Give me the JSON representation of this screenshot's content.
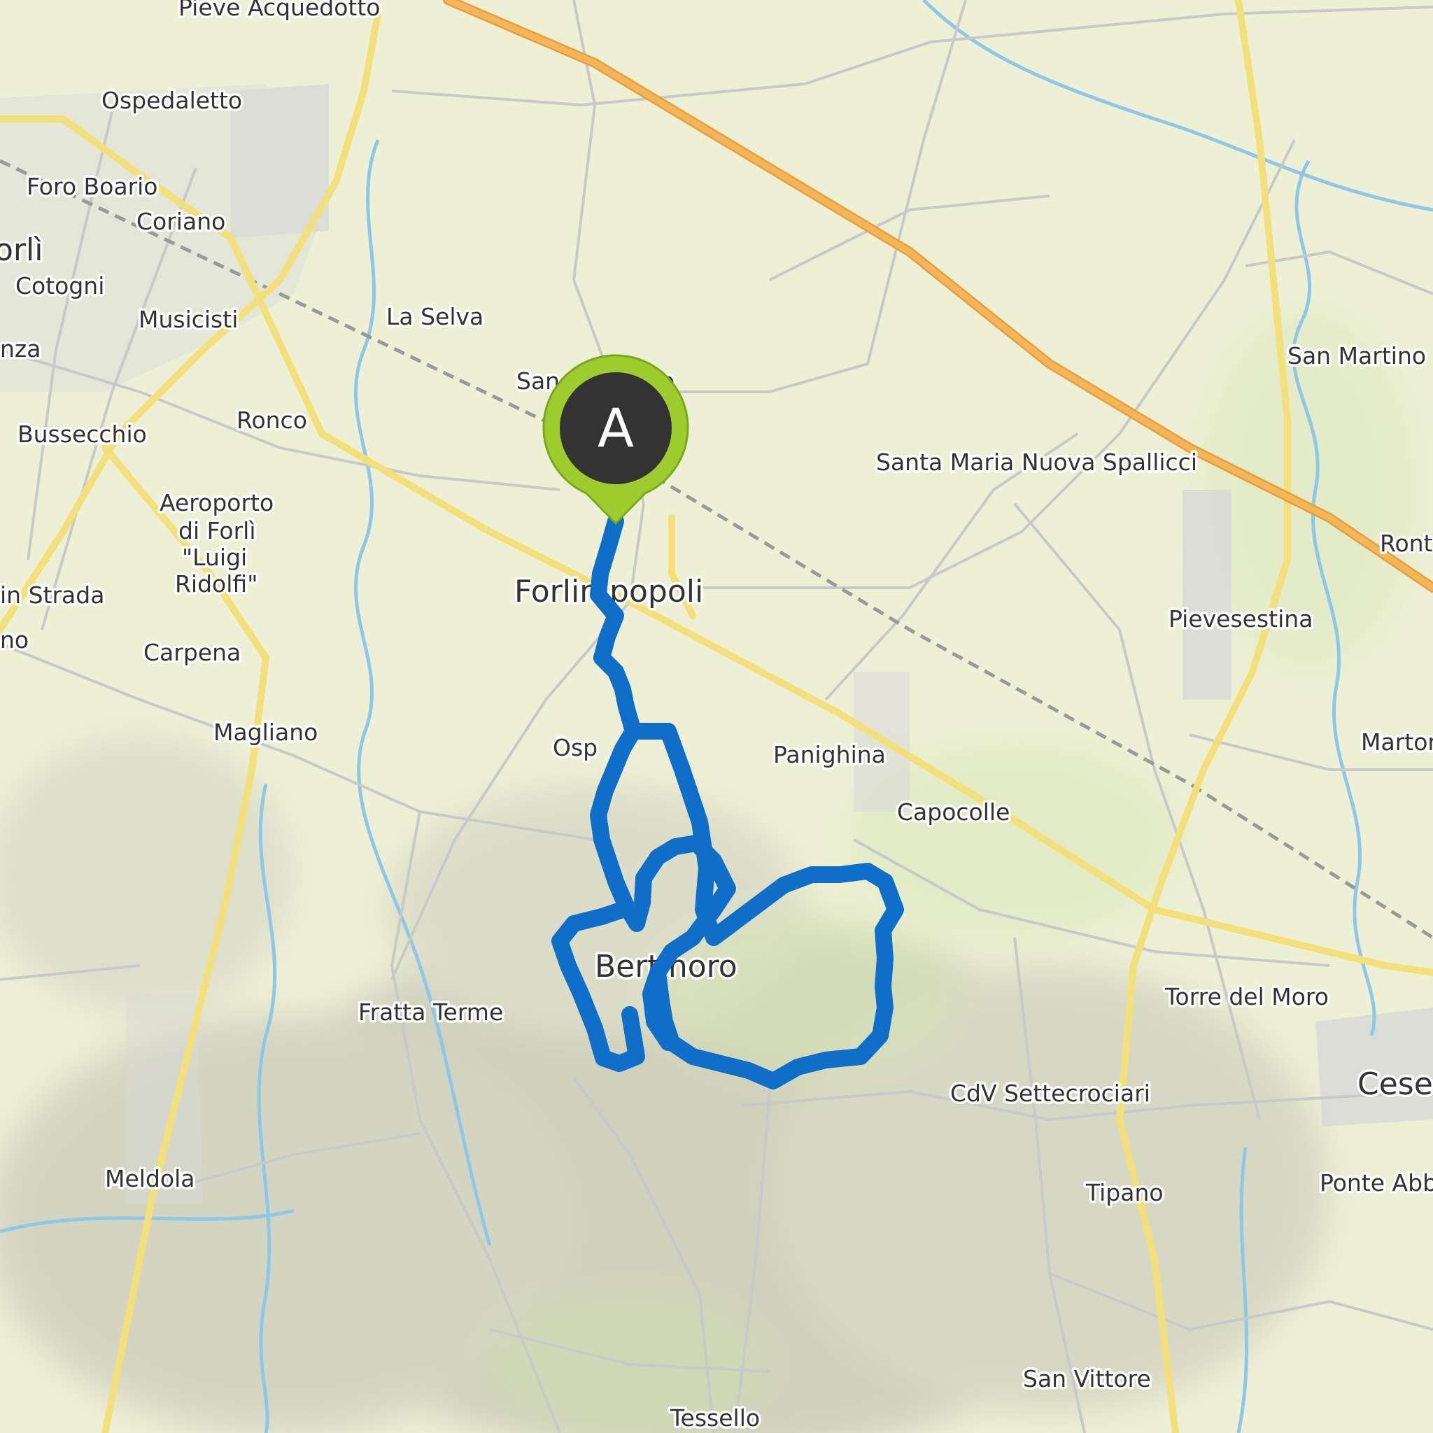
{
  "marker": {
    "letter": "A",
    "color": "#9ccc2e",
    "inner_color": "#333333"
  },
  "route": {
    "color": "#0f6ec7"
  },
  "colors": {
    "background": "#eef0d6",
    "highway": "#f5b558",
    "main_road": "#f3e07a",
    "minor_road": "#d0d0d0",
    "river": "#8ec8e8",
    "urban": "#d9d9d9"
  },
  "places": [
    "Pieve Acquedotto",
    "Ospedaletto",
    "Foro Boario",
    "Coriano",
    "orlì",
    "Cotogni",
    "Musicisti",
    "La Selva",
    "nza",
    "Bussecchio",
    "Ronco",
    "Aeroporto",
    "di Forlì",
    "\"Luigi",
    "Ridolfi\"",
    "in Strada",
    "no",
    "Carpena",
    "Magliano",
    "Forlimpopoli",
    "Osp",
    "Panighina",
    "Capocolle",
    "Santa Maria Nuova Spallicci",
    "San Martino",
    "Ront",
    "Pievesestina",
    "Marton",
    "Bertinoro",
    "Fratta Terme",
    "Torre del Moro",
    "CdV Settecrociari",
    "Cesen",
    "Meldola",
    "Tipano",
    "Ponte Abb",
    "San Vittore",
    "Tessello",
    "San Leonardo"
  ]
}
